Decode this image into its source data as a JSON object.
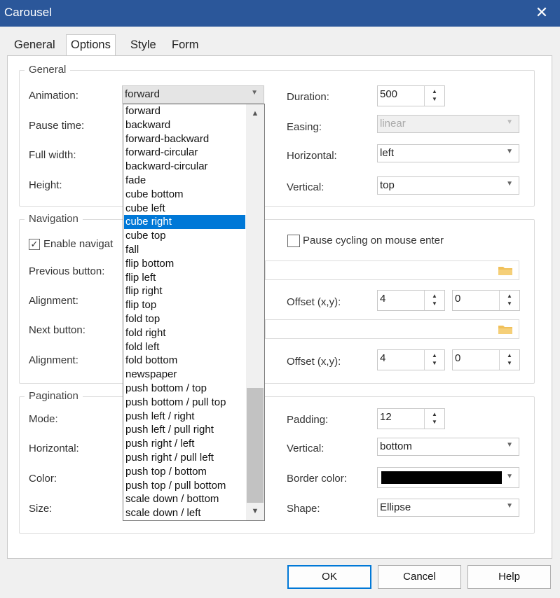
{
  "window": {
    "title": "Carousel"
  },
  "tabs": [
    {
      "label": "General",
      "active": false
    },
    {
      "label": "Options",
      "active": true
    },
    {
      "label": "Style",
      "active": false
    },
    {
      "label": "Form",
      "active": false
    }
  ],
  "general": {
    "group_title": "General",
    "animation_label": "Animation:",
    "animation_value": "forward",
    "pause_time_label": "Pause time:",
    "full_width_label": "Full width:",
    "height_label": "Height:",
    "duration_label": "Duration:",
    "duration_value": "500",
    "easing_label": "Easing:",
    "easing_value": "linear",
    "horizontal_label": "Horizontal:",
    "horizontal_value": "left",
    "vertical_label": "Vertical:",
    "vertical_value": "top"
  },
  "animation_options": [
    "forward",
    "backward",
    "forward-backward",
    "forward-circular",
    "backward-circular",
    "fade",
    "cube bottom",
    "cube left",
    "cube right",
    "cube top",
    "fall",
    "flip bottom",
    "flip left",
    "flip right",
    "flip top",
    "fold top",
    "fold right",
    "fold left",
    "fold bottom",
    "newspaper",
    "push bottom / top",
    "push bottom / pull top",
    "push left / right",
    "push left / pull right",
    "push right / left",
    "push right / pull left",
    "push top / bottom",
    "push top / pull bottom",
    "scale down / bottom",
    "scale down / left"
  ],
  "animation_selected": "cube right",
  "navigation": {
    "group_title": "Navigation",
    "enable_label": "Enable navigat",
    "enable_checked": true,
    "pause_label": "Pause cycling on mouse enter",
    "pause_checked": false,
    "prev_button_label": "Previous button:",
    "alignment1_label": "Alignment:",
    "offset1_label": "Offset (x,y):",
    "offset1_x": "4",
    "offset1_y": "0",
    "next_button_label": "Next button:",
    "alignment2_label": "Alignment:",
    "offset2_label": "Offset (x,y):",
    "offset2_x": "4",
    "offset2_y": "0"
  },
  "pagination": {
    "group_title": "Pagination",
    "mode_label": "Mode:",
    "horizontal_label": "Horizontal:",
    "color_label": "Color:",
    "size_label": "Size:",
    "padding_label": "Padding:",
    "padding_value": "12",
    "vertical_label": "Vertical:",
    "vertical_value": "bottom",
    "border_color_label": "Border color:",
    "border_color_value": "#000000",
    "shape_label": "Shape:",
    "shape_value": "Ellipse"
  },
  "buttons": {
    "ok": "OK",
    "cancel": "Cancel",
    "help": "Help"
  },
  "icons": {
    "close": "✕",
    "chevron_down": "▼",
    "spin_up": "▲",
    "spin_down": "▼",
    "check": "✓"
  },
  "colors": {
    "titlebar": "#2b579a",
    "selection": "#0078d7",
    "folder": "#f0c05a"
  }
}
